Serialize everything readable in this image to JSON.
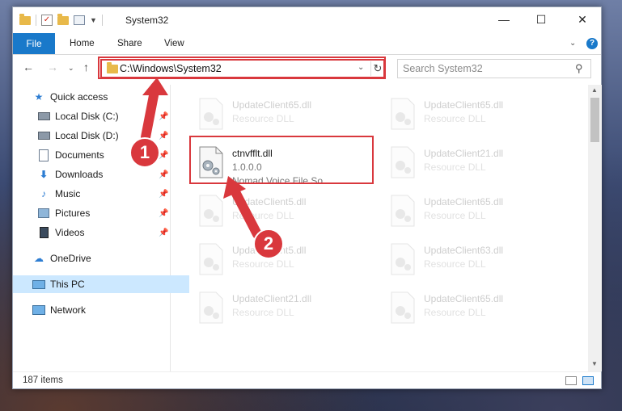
{
  "titlebar": {
    "title": "System32",
    "minimize": "—",
    "maximize": "☐",
    "close": "✕"
  },
  "ribbon": {
    "tabs": {
      "file": "File",
      "home": "Home",
      "share": "Share",
      "view": "View"
    },
    "help": "?"
  },
  "address": {
    "path": "C:\\Windows\\System32",
    "search_placeholder": "Search System32"
  },
  "sidebar": {
    "items": [
      {
        "label": "Quick access",
        "icon": "star-icon"
      },
      {
        "label": "Local Disk (C:)",
        "icon": "drive-icon",
        "pinned": true
      },
      {
        "label": "Local Disk (D:)",
        "icon": "drive-icon",
        "pinned": true
      },
      {
        "label": "Documents",
        "icon": "documents-icon",
        "pinned": true
      },
      {
        "label": "Downloads",
        "icon": "download-icon",
        "pinned": true
      },
      {
        "label": "Music",
        "icon": "music-icon",
        "pinned": true
      },
      {
        "label": "Pictures",
        "icon": "pictures-icon",
        "pinned": true
      },
      {
        "label": "Videos",
        "icon": "videos-icon",
        "pinned": true
      },
      {
        "label": "OneDrive",
        "icon": "cloud-icon"
      },
      {
        "label": "This PC",
        "icon": "computer-icon",
        "selected": true
      },
      {
        "label": "Network",
        "icon": "network-icon"
      }
    ]
  },
  "files": {
    "highlighted": {
      "name": "ctnvfflt.dll",
      "version": "1.0.0.0",
      "description": "Nomad Voice File So..."
    },
    "faded": [
      {
        "name": "UpdateClient65.dll",
        "type": "Resource DLL"
      },
      {
        "name": "UpdateClient65.dll",
        "type": "Resource DLL"
      },
      {
        "name": "UpdateClient21.dll",
        "type": "Resource DLL"
      },
      {
        "name": "UpdateClient5.dll",
        "type": "Resource DLL"
      },
      {
        "name": "UpdateClient65.dll",
        "type": "Resource DLL"
      },
      {
        "name": "UpdateClient5.dll",
        "type": "Resource DLL"
      },
      {
        "name": "UpdateClient63.dll",
        "type": "Resource DLL"
      },
      {
        "name": "UpdateClient21.dll",
        "type": "Resource DLL"
      },
      {
        "name": "UpdateClient65.dll",
        "type": "Resource DLL"
      }
    ]
  },
  "status": {
    "item_count": "187 items"
  },
  "annotations": {
    "step1": "1",
    "step2": "2"
  },
  "colors": {
    "accent": "#1979ca",
    "highlight": "#d9383d"
  }
}
